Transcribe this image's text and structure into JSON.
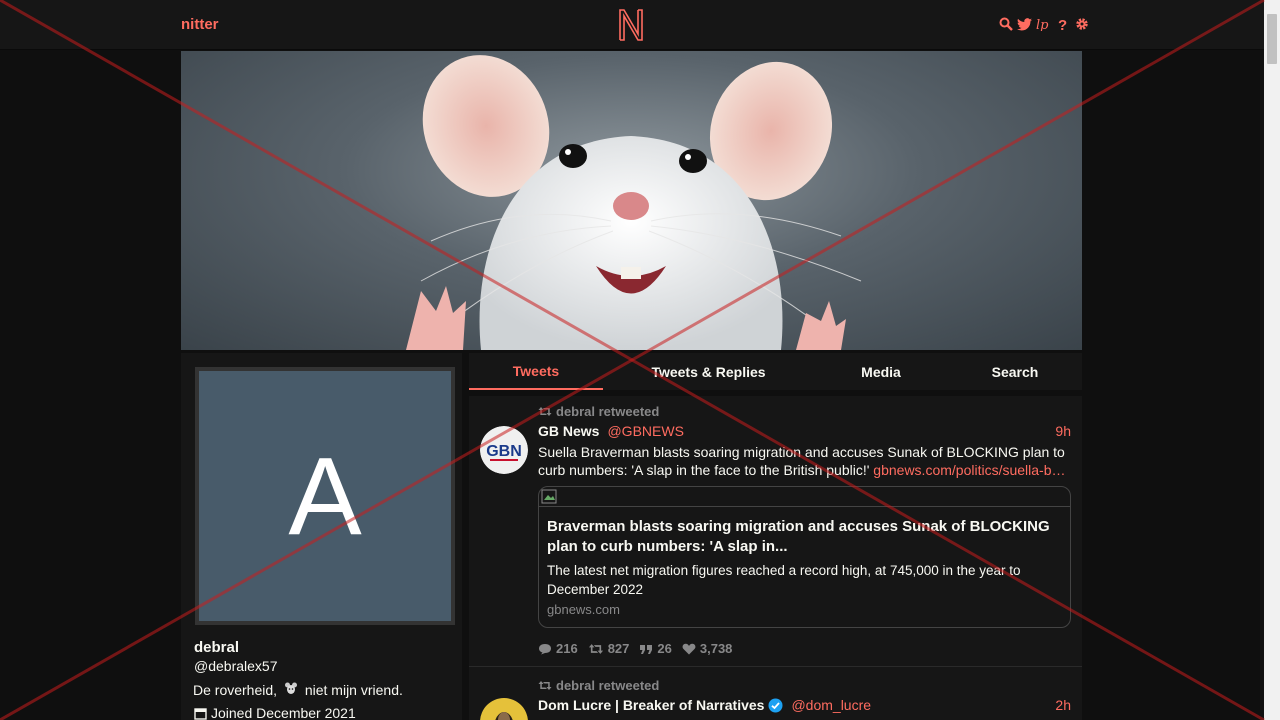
{
  "navbar": {
    "brand": "nitter",
    "icons": [
      "search-icon",
      "twitter-icon",
      "rss-icon",
      "question-icon",
      "gear-icon"
    ]
  },
  "profile": {
    "avatar_letter": "A",
    "fullname": "debral",
    "username": "@debralex57",
    "bio_part1": "De roverheid,",
    "bio_part2": "niet mijn vriend.",
    "joined": "Joined December 2021"
  },
  "tabs": [
    {
      "label": "Tweets",
      "active": true
    },
    {
      "label": "Tweets & Replies",
      "active": false
    },
    {
      "label": "Media",
      "active": false
    },
    {
      "label": "Search",
      "active": false
    }
  ],
  "tweets": [
    {
      "retweet_header": "debral retweeted",
      "fullname": "GB News",
      "handle": "@GBNEWS",
      "time": "9h",
      "text": "Suella Braverman blasts soaring migration and accuses Sunak of BLOCKING plan to curb numbers: 'A slap in the face to the British public!' ",
      "link": "gbnews.com/politics/suella-b…",
      "avatar_text": "GBN",
      "card": {
        "title": "Braverman blasts soaring migration and accuses Sunak of BLOCKING plan to curb numbers: 'A slap in...",
        "description": "The latest net migration figures reached a record high, at 745,000 in the year to December 2022",
        "destination": "gbnews.com"
      },
      "stats": {
        "replies": "216",
        "retweets": "827",
        "quotes": "26",
        "likes": "3,738"
      }
    },
    {
      "retweet_header": "debral retweeted",
      "fullname": "Dom Lucre | Breaker of Narratives",
      "handle": "@dom_lucre",
      "time": "2h",
      "verified": true
    }
  ],
  "colors": {
    "accent": "#ff6c60",
    "background": "#0f0f0f",
    "panel": "#161616",
    "avatar_bg": "#485b6a"
  }
}
